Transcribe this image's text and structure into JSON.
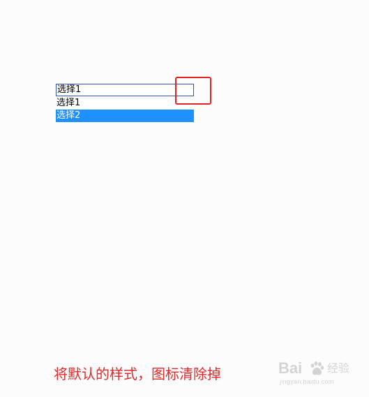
{
  "select": {
    "selected_value": "选择1",
    "options": [
      {
        "label": "选择1",
        "highlighted": false
      },
      {
        "label": "选择2",
        "highlighted": true
      }
    ]
  },
  "caption": "将默认的样式，图标清除掉",
  "watermark": {
    "brand_en": "Bai",
    "brand_cn": "经验",
    "site": "jingyan.baidu.com"
  },
  "colors": {
    "select_border": "#2f56a0",
    "highlight": "#1e90ff",
    "annotation": "#e32222",
    "caption": "#e02b2b"
  }
}
